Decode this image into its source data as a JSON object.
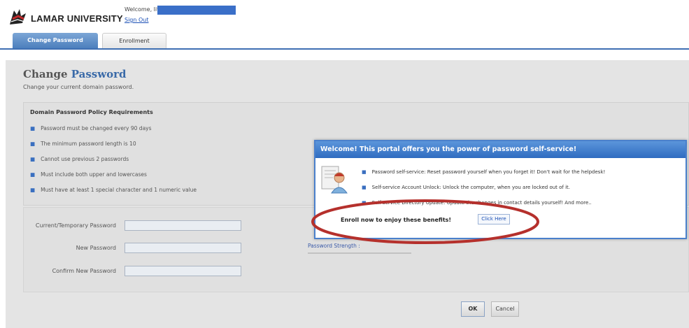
{
  "header": {
    "logo_text": "LAMAR UNIVERSITY",
    "welcome": "Welcome, lit_",
    "sign_out": "Sign Out"
  },
  "tabs": [
    {
      "label": "Change Password",
      "active": true
    },
    {
      "label": "Enrollment",
      "active": false
    }
  ],
  "page": {
    "title_part1": "Change ",
    "title_part2": "Password",
    "subtitle": "Change your current domain password."
  },
  "policy": {
    "heading": "Domain Password Policy Requirements",
    "items": [
      "Password must be changed every 90 days",
      "The minimum password length is 10",
      "Cannot use previous 2 passwords",
      "Must include both upper and lowercases",
      "Must have at least 1 special character and 1 numeric value"
    ]
  },
  "form": {
    "current_label": "Current/Temporary Password",
    "new_label": "New Password",
    "confirm_label": "Confirm New Password",
    "strength_label": "Password Strength :",
    "current_value": "",
    "new_value": "",
    "confirm_value": ""
  },
  "buttons": {
    "ok": "OK",
    "cancel": "Cancel"
  },
  "popup": {
    "title": "Welcome! This portal offers you the power of password self-service!",
    "items": [
      "Password self-service: Reset password yourself when you forget it! Don't wait for the helpdesk!",
      "Self-service Account Unlock: Unlock the computer, when you are locked out of it.",
      "Self-service Directory Update: Update the changes in contact details yourself! And more.."
    ],
    "enroll_text": "Enroll now to enjoy these benefits!",
    "click_here": "Click Here"
  },
  "colors": {
    "accent": "#3f6fb3",
    "popup_header": "#2f6cc0",
    "annotation": "#b5302c"
  },
  "icons": {
    "logo": "cardinal-logo-icon",
    "popup": "user-document-icon",
    "bullet": "bullet-icon"
  }
}
